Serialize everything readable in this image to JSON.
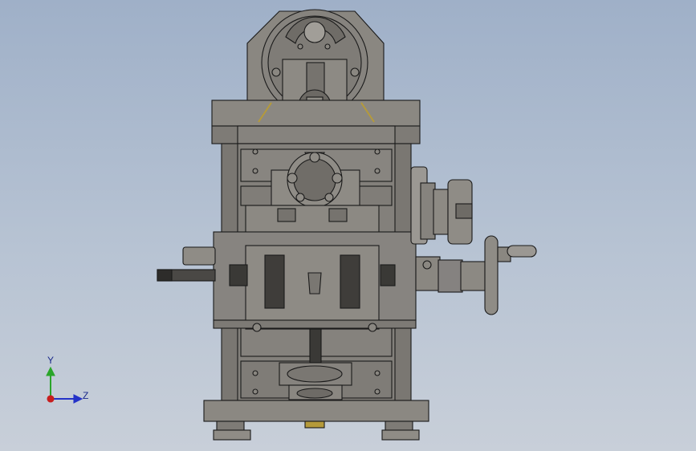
{
  "viewport": {
    "background_top": "#9fb0c8",
    "background_bottom": "#c8cfd9",
    "part_color": "#7d7a75",
    "edge_color": "#1a1a1a"
  },
  "triad": {
    "y_label": "Y",
    "z_label": "Z",
    "y_color": "#2aa52a",
    "z_color": "#2433c8",
    "x_color": "#c81e1e"
  }
}
